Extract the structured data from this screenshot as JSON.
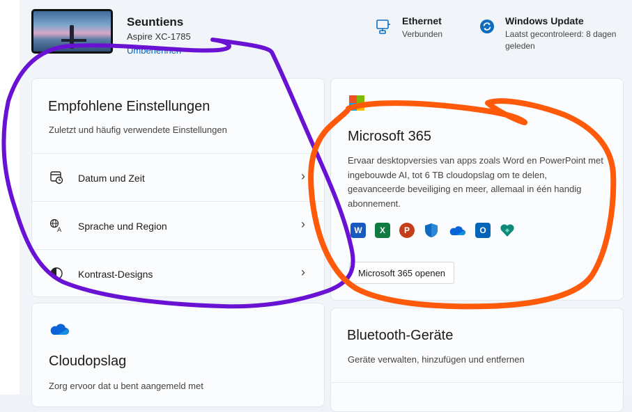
{
  "device": {
    "name": "Seuntiens",
    "model": "Aspire XC-1785",
    "rename_label": "Umbenennen"
  },
  "header": {
    "ethernet": {
      "title": "Ethernet",
      "status": "Verbunden",
      "icon": "ethernet-icon"
    },
    "windows_update": {
      "title": "Windows Update",
      "status_line1": "Laatst gecontroleerd: 8 dagen",
      "status_line2": "geleden",
      "icon": "sync-icon"
    }
  },
  "recommended": {
    "title": "Empfohlene Einstellungen",
    "subtitle": "Zuletzt und häufig verwendete Einstellungen",
    "items": [
      {
        "label": "Datum und Zeit",
        "icon": "calendar-clock-icon"
      },
      {
        "label": "Sprache und Region",
        "icon": "language-icon"
      },
      {
        "label": "Kontrast-Designs",
        "icon": "contrast-icon"
      }
    ],
    "chevron": "›"
  },
  "m365": {
    "title": "Microsoft 365",
    "description": "Ervaar desktopversies van apps zoals Word en PowerPoint met ingebouwde AI, tot 6 TB cloudopslag om te delen, geavanceerde beveiliging en meer, allemaal in één handig abonnement.",
    "apps": [
      {
        "name": "word-icon",
        "letter": "W",
        "color": "#185abd"
      },
      {
        "name": "excel-icon",
        "letter": "X",
        "color": "#107c41"
      },
      {
        "name": "powerpoint-icon",
        "letter": "P",
        "color": "#c43e1c"
      },
      {
        "name": "defender-icon",
        "letter": "",
        "color": "#0f6cbd"
      },
      {
        "name": "onedrive-icon",
        "letter": "",
        "color": "#0a64d8"
      },
      {
        "name": "outlook-icon",
        "letter": "O",
        "color": "#0364b8"
      },
      {
        "name": "family-safety-icon",
        "letter": "",
        "color": "#0e8a7a"
      }
    ],
    "button_label": "Microsoft 365 openen"
  },
  "cloud": {
    "title": "Cloudopslag",
    "subtitle": "Zorg ervoor dat u bent aangemeld met",
    "icon": "cloud-icon"
  },
  "bluetooth": {
    "title": "Bluetooth-Geräte",
    "subtitle": "Geräte verwalten, hinzufügen und entfernen"
  },
  "colors": {
    "accent": "#005fb8",
    "purple_annotation": "#6a12d4",
    "orange_annotation": "#ff5a0a"
  }
}
